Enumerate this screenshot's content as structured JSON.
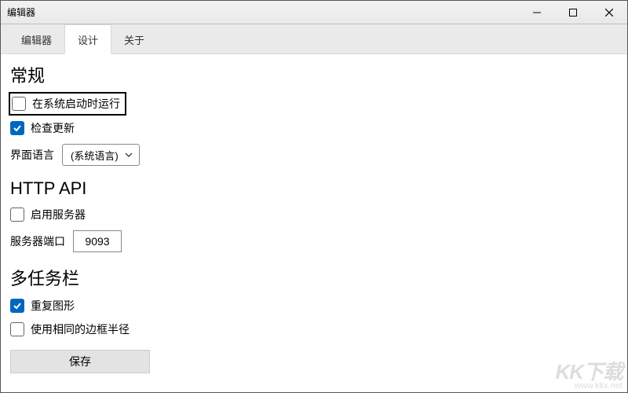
{
  "window": {
    "title": "编辑器"
  },
  "tabs": {
    "items": [
      "编辑器",
      "设计",
      "关于"
    ],
    "active_index": 1
  },
  "sections": {
    "general": {
      "title": "常规",
      "run_on_startup": {
        "label": "在系统启动时运行",
        "checked": false,
        "focused": true
      },
      "check_updates": {
        "label": "检查更新",
        "checked": true
      },
      "language_label": "界面语言",
      "language_value": "(系统语言)"
    },
    "http_api": {
      "title": "HTTP API",
      "enable_server": {
        "label": "启用服务器",
        "checked": false
      },
      "port_label": "服务器端口",
      "port_value": "9093"
    },
    "multi_taskbar": {
      "title": "多任务栏",
      "repeat_shape": {
        "label": "重复图形",
        "checked": true
      },
      "same_radius": {
        "label": "使用相同的边框半径",
        "checked": false
      }
    }
  },
  "save_label": "保存",
  "watermark": {
    "brand": "KK下载",
    "url": "www.kkx.net"
  }
}
